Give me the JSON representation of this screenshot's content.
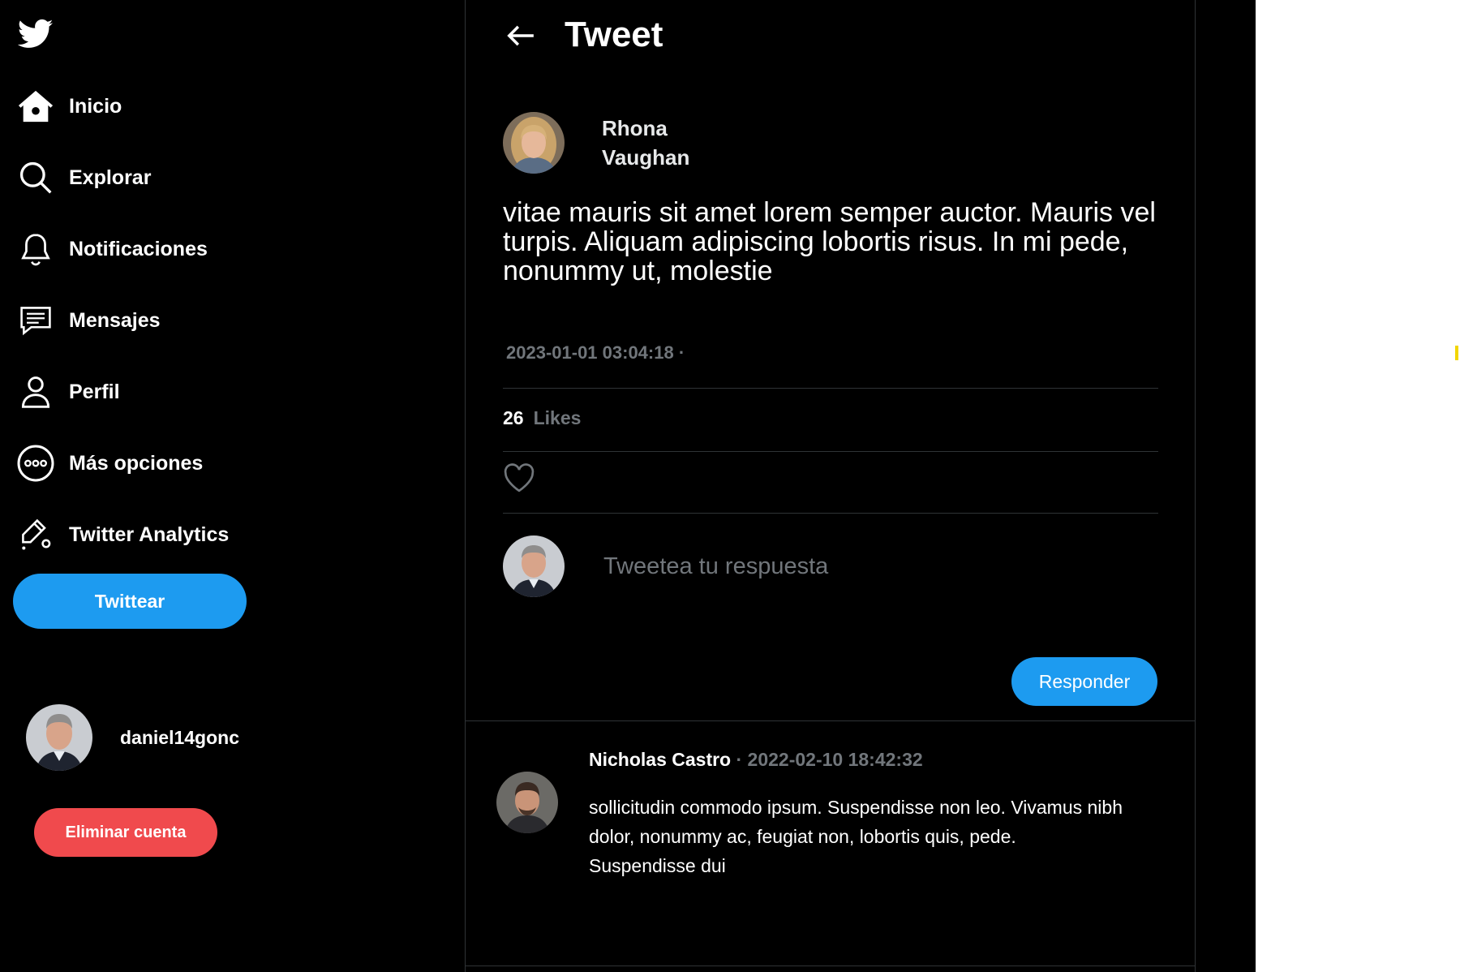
{
  "sidebar": {
    "nav": [
      {
        "label": "Inicio",
        "icon": "home-icon"
      },
      {
        "label": "Explorar",
        "icon": "search-icon"
      },
      {
        "label": "Notificaciones",
        "icon": "bell-icon"
      },
      {
        "label": "Mensajes",
        "icon": "message-icon"
      },
      {
        "label": "Perfil",
        "icon": "user-icon"
      },
      {
        "label": "Más opciones",
        "icon": "more-icon"
      },
      {
        "label": "Twitter Analytics",
        "icon": "analytics-icon"
      }
    ],
    "tweet_button": "Twittear",
    "user": {
      "name": "daniel14gonc"
    },
    "delete_button": "Eliminar cuenta"
  },
  "main": {
    "title": "Tweet",
    "tweet": {
      "author_first": "Rhona",
      "author_last": "Vaughan",
      "text": "vitae mauris sit amet lorem semper auctor. Mauris vel turpis. Aliquam adipiscing lobortis risus. In mi pede, nonummy ut, molestie",
      "date": "2023-01-01 03:04:18 ·",
      "likes_count": "26",
      "likes_label": "Likes"
    },
    "reply_box": {
      "placeholder": "Tweetea tu respuesta",
      "button": "Responder"
    },
    "replies": [
      {
        "author": "Nicholas Castro",
        "meta": " · 2022-02-10 18:42:32",
        "text": "sollicitudin commodo ipsum. Suspendisse non leo. Vivamus nibh dolor, nonummy ac, feugiat non, lobortis quis, pede. Suspendisse dui"
      }
    ]
  },
  "colors": {
    "accent": "#1d9bf0",
    "danger": "#f04a4d",
    "muted": "#71767b",
    "divider": "#2f3336"
  }
}
